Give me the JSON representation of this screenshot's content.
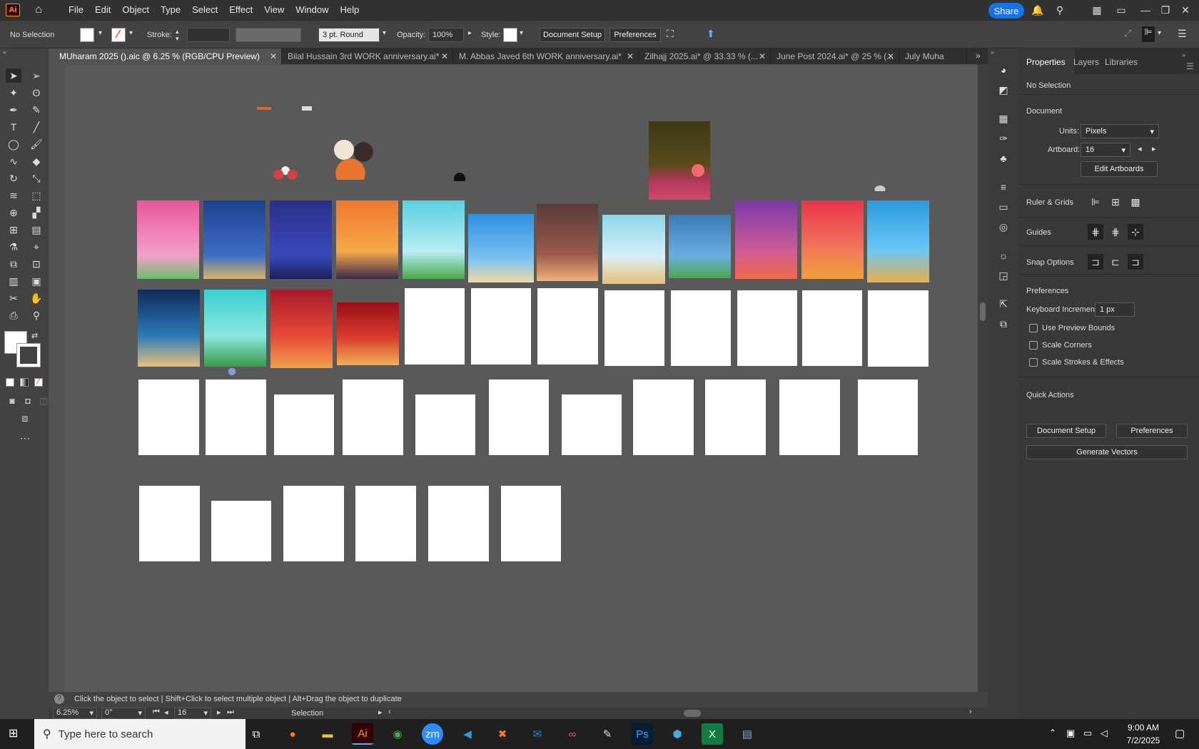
{
  "menubar": {
    "app_logo": "Ai",
    "items": [
      "File",
      "Edit",
      "Object",
      "Type",
      "Select",
      "Effect",
      "View",
      "Window",
      "Help"
    ],
    "share": "Share"
  },
  "control": {
    "selection": "No Selection",
    "stroke_label": "Stroke:",
    "brush": "3 pt. Round",
    "opacity_label": "Opacity:",
    "opacity_value": "100%",
    "style_label": "Style:",
    "document_setup": "Document Setup",
    "preferences": "Preferences"
  },
  "tabs": [
    {
      "label": "MUharam 2025 ().aic @ 6.25 % (RGB/CPU Preview)"
    },
    {
      "label": "Bilal Hussain  3rd  WORK anniversary.ai*"
    },
    {
      "label": "M. Abbas Javed  6th  WORK anniversary.ai*"
    },
    {
      "label": "Zilhajj 2025.ai* @ 33.33 % (..."
    },
    {
      "label": "June Post 2024.ai* @ 25 % (..."
    },
    {
      "label": "July Muha"
    }
  ],
  "panel": {
    "tabs": [
      "Properties",
      "Layers",
      "Libraries"
    ],
    "no_selection": "No Selection",
    "document_head": "Document",
    "units_label": "Units:",
    "units_value": "Pixels",
    "artboard_label": "Artboard:",
    "artboard_value": "16",
    "edit_artboards": "Edit Artboards",
    "ruler_grids": "Ruler & Grids",
    "guides": "Guides",
    "snap_options": "Snap Options",
    "preferences_head": "Preferences",
    "keyboard_increment_label": "Keyboard Increment:",
    "keyboard_increment_value": "1 px",
    "use_preview_bounds": "Use Preview Bounds",
    "scale_corners": "Scale Corners",
    "scale_strokes": "Scale Strokes & Effects",
    "quick_actions": "Quick Actions",
    "qa_document_setup": "Document Setup",
    "qa_preferences": "Preferences",
    "generate_vectors": "Generate Vectors"
  },
  "status": {
    "hint": "Click the object to select  |  Shift+Click to select multiple object  |  Alt+Drag the object to duplicate",
    "zoom": "6.25%",
    "rotation": "0°",
    "artboard_num": "16",
    "tool": "Selection"
  },
  "taskbar": {
    "search_placeholder": "Type here to search",
    "time": "9:00 AM",
    "date": "7/2/2025"
  },
  "colors": {
    "accent": "#1473e6",
    "ai_orange": "#ff9a00"
  }
}
